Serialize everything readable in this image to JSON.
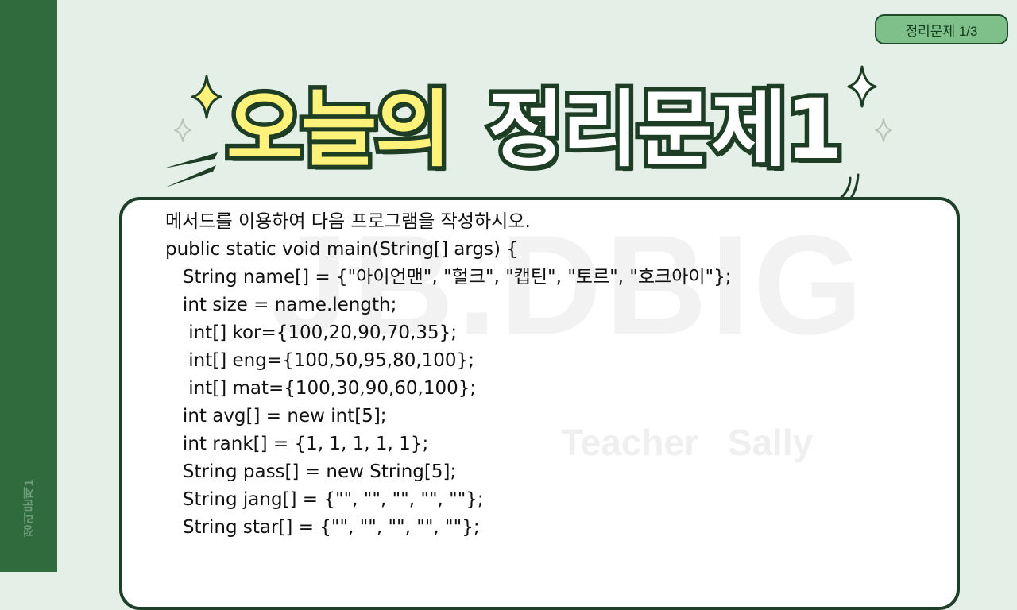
{
  "sidebar": {
    "vertical_label": "정리문제1"
  },
  "badge": {
    "label": "정리문제 1/3"
  },
  "title": {
    "part1": "오늘의",
    "part2": "정리문제1"
  },
  "watermark": {
    "main": "JB.DBIG",
    "sub": "Teacher Sally"
  },
  "problem": {
    "lines": [
      "메서드를 이용하여 다음 프로그램을 작성하시오.",
      "public static void main(String[] args) {",
      "   String name[] = {\"아이언맨\", \"헐크\", \"캡틴\", \"토르\", \"호크아이\"};",
      "   int size = name.length;",
      "    int[] kor={100,20,90,70,35};",
      "    int[] eng={100,50,95,80,100};",
      "    int[] mat={100,30,90,60,100};",
      "   int avg[] = new int[5];",
      "   int rank[] = {1, 1, 1, 1, 1};",
      "   String pass[] = new String[5];",
      "   String jang[] = {\"\", \"\", \"\", \"\", \"\"};",
      "   String star[] = {\"\", \"\", \"\", \"\", \"\"};"
    ]
  },
  "colors": {
    "background": "#e4efe7",
    "sidebar": "#2f6b3c",
    "badge": "#7fc08a",
    "title_highlight": "#fff27a",
    "outline": "#1d3d25"
  },
  "icons": [
    "sparkle-icon",
    "speed-lines-icon"
  ]
}
